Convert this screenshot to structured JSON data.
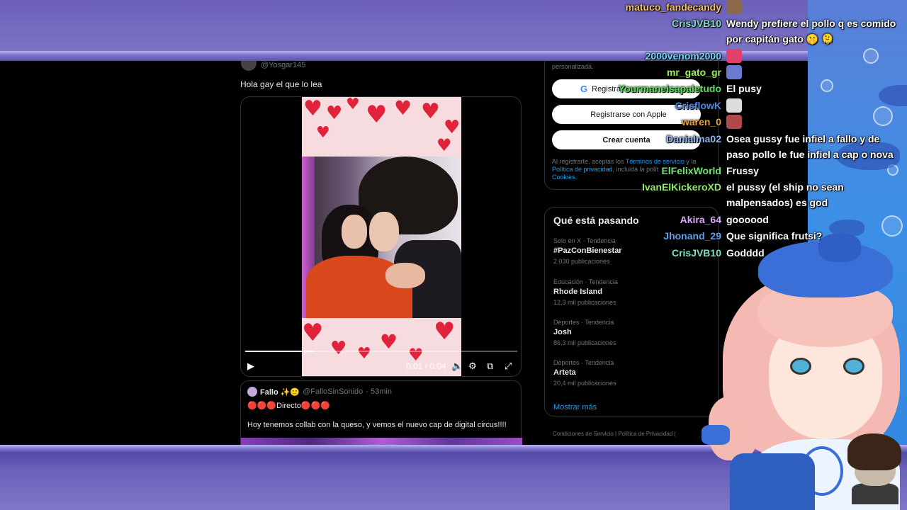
{
  "tweet": {
    "handle": "@Yosgar145",
    "text": "Hola gay el que lo lea",
    "video": {
      "current_time": "0:01",
      "duration": "0:04",
      "time_display": "0:01 / 0:04",
      "progress_fraction": 0.25
    }
  },
  "quoted": {
    "name": "Fallo ✨🙂",
    "handle": "@FalloSinSonido",
    "age": "· 53min",
    "line1": "🔴🔴🔴Directo🔴🔴🔴",
    "line2": "Hoy tenemos collab con la queso, y vemos el nuevo cap de digital circus!!!!"
  },
  "signup": {
    "personalizada": "personalizada.",
    "google_label": "Registra",
    "apple_label": "Registrarse con Apple",
    "create_label": "Crear cuenta",
    "legal_prefix": "Al registrarte, aceptas los ",
    "terms": "Términos de servicio",
    "legal_mid": " y la ",
    "privacy": "Política de privacidad",
    "legal_mid2": ", incluida la polít",
    "cookies": "Cookies."
  },
  "trends": {
    "title": "Qué está pasando",
    "items": [
      {
        "category": "Solo en X · Tendencia",
        "name": "#PazConBienestar",
        "posts": "2.030 publicaciones"
      },
      {
        "category": "Educación · Tendencia",
        "name": "Rhode Island",
        "posts": "12,3 mil publicaciones"
      },
      {
        "category": "Deportes · Tendencia",
        "name": "Josh",
        "posts": "86,3 mil publicaciones"
      },
      {
        "category": "Deportes · Tendencia",
        "name": "Arteta",
        "posts": "20,4 mil publicaciones"
      }
    ],
    "show_more": "Mostrar más",
    "footer": "Condiciones de Servicio  |  Política de Privacidad  |"
  },
  "chat": {
    "messages": [
      {
        "user": "matuco_fandecandy",
        "color": "#f2c36b",
        "text": "",
        "emote": true
      },
      {
        "user": "CrisJVB10",
        "color": "#7fe0c8",
        "text": "Wendy prefiere el pollo q es comido por capitán gato 🤫 🫠"
      },
      {
        "user": "2000venom2000",
        "color": "#6dd7f5",
        "text": "",
        "emote": true
      },
      {
        "user": "mr_gato_gr",
        "color": "#9cf25a",
        "text": "",
        "emote": true
      },
      {
        "user": "Yourmaneisapaletudo",
        "color": "#58e05a",
        "text": "El pusy"
      },
      {
        "user": "CrisflowK",
        "color": "#4f86e8",
        "text": "",
        "emote": true
      },
      {
        "user": "waren_0",
        "color": "#e6a23a",
        "text": "",
        "emote": true
      },
      {
        "user": "Danialma02",
        "color": "#8fb5f0",
        "text": "Osea gussy fue infiel a fallo y de paso pollo le fue infiel a cap o nova"
      },
      {
        "user": "ElFelixWorld",
        "color": "#6ee86a",
        "text": "Frussy"
      },
      {
        "user": "IvanElKickeroXD",
        "color": "#8fe86a",
        "text": "el pussy (el ship no sean malpensados) es god"
      },
      {
        "user": "Akira_64",
        "color": "#d6a8f5",
        "text": "goooood"
      },
      {
        "user": "Jhonand_29",
        "color": "#5aa0f0",
        "text": "Que significa frutsi?"
      },
      {
        "user": "CrisJVB10",
        "color": "#7fe0c8",
        "text": "Godddd"
      }
    ]
  },
  "colors": {
    "accent": "#1d9bf0",
    "frame": "#6b5fb8",
    "heart": "#e0233a"
  }
}
